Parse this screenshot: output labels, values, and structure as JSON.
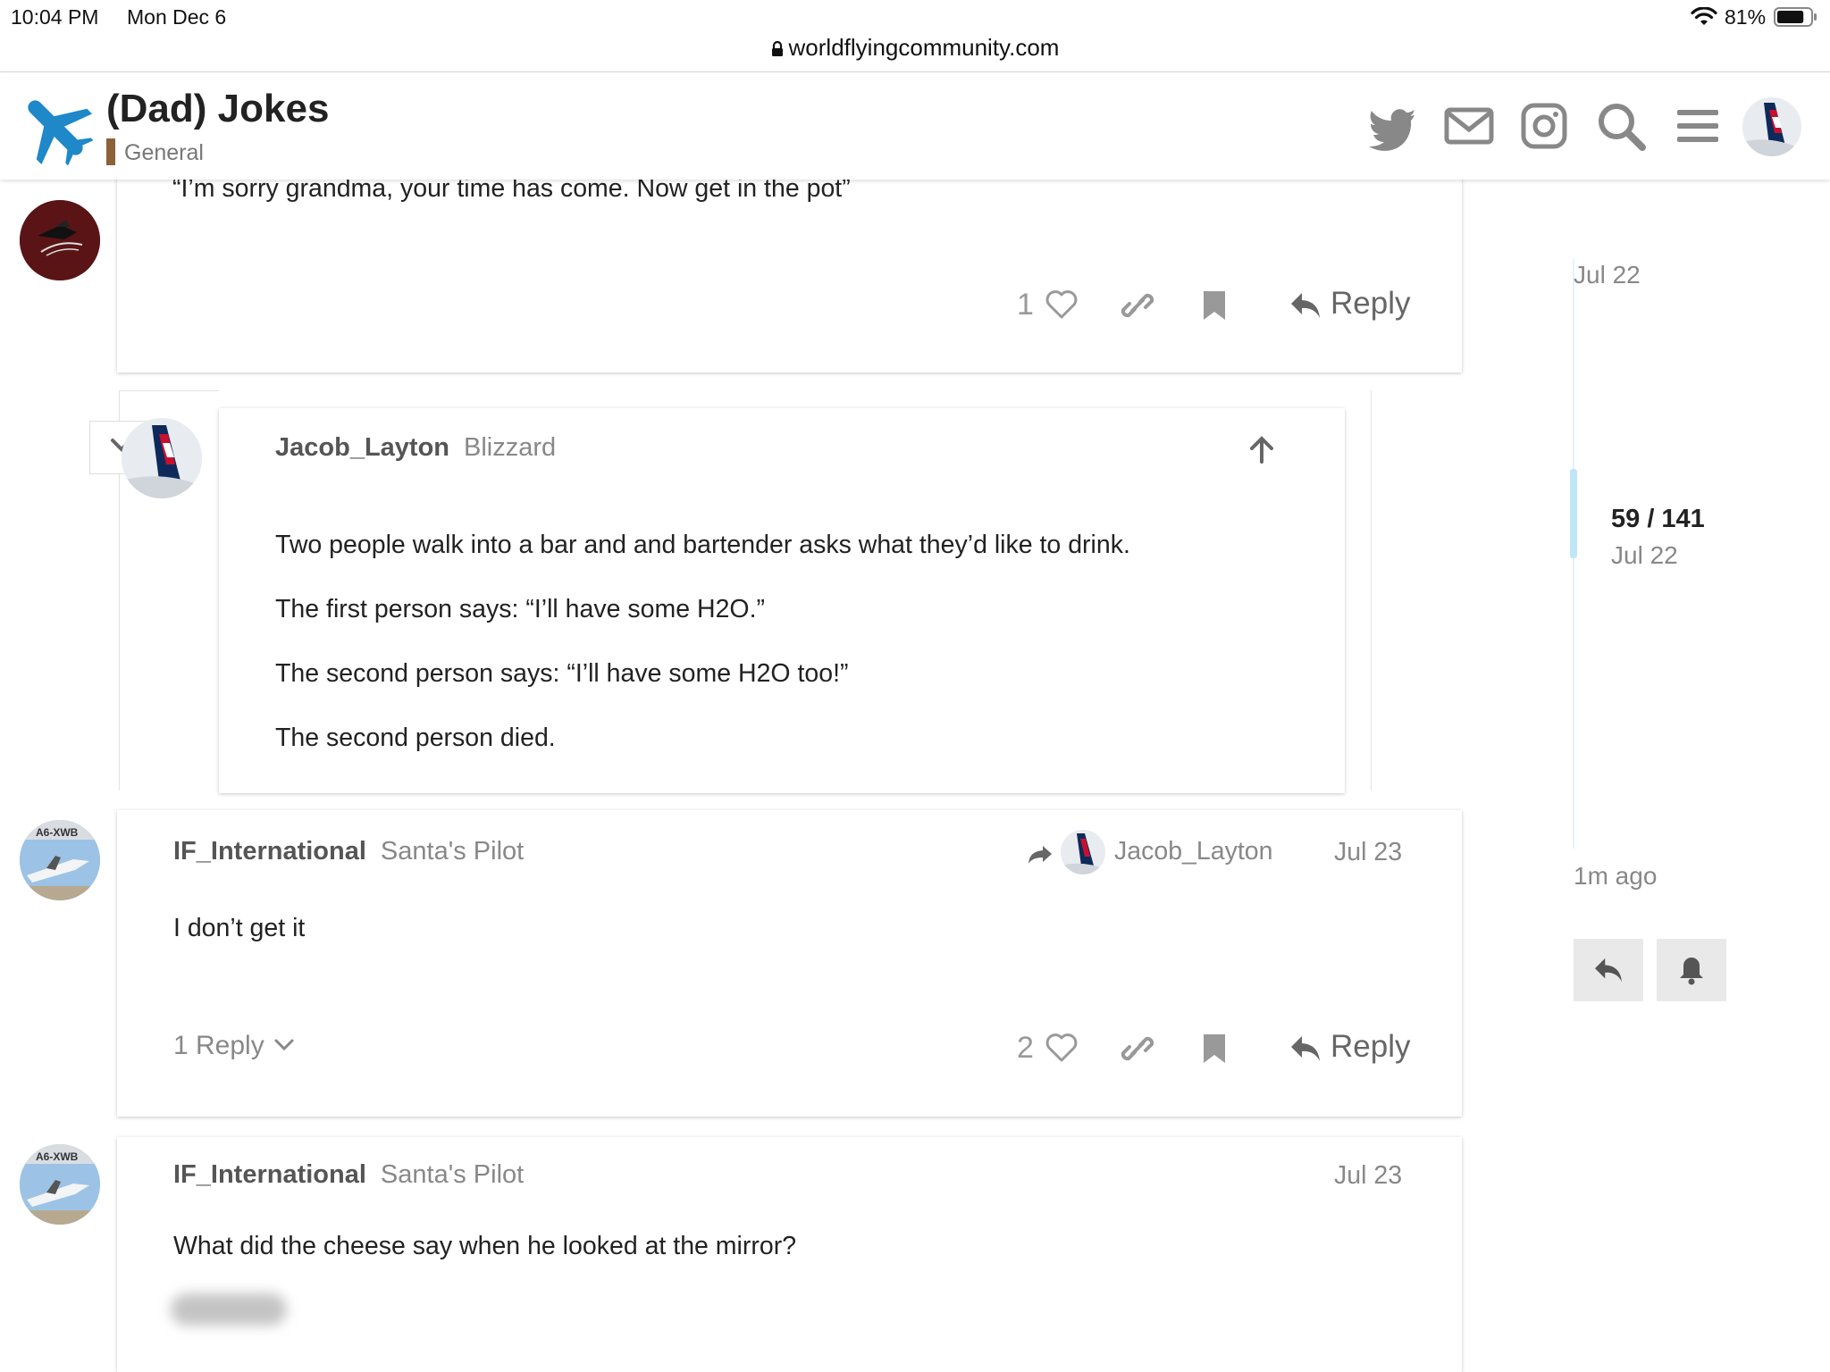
{
  "status": {
    "time": "10:04 PM",
    "date": "Mon Dec 6",
    "battery": "81%",
    "battery_level": 0.81,
    "url": "worldflyingcommunity.com"
  },
  "header": {
    "title": "(Dad) Jokes",
    "category": "General",
    "category_color": "#8C6238",
    "logo_color": "#1E88C8",
    "icons": [
      "twitter-icon",
      "mail-icon",
      "instagram-icon",
      "search-icon",
      "menu-icon",
      "user-avatar"
    ]
  },
  "posts": [
    {
      "text": "“I’m sorry grandma, your time has come. Now get in the pot”",
      "likes": "1",
      "reply_label": "Reply"
    },
    {
      "username": "Jacob_Layton",
      "user_title": "Blizzard",
      "paragraphs": [
        "Two people walk into a bar and and bartender asks what they’d like to drink.",
        "The first person says: “I’ll have some H2O.”",
        "The second person says: “I’ll have some H2O too!”",
        "The second person died."
      ]
    },
    {
      "username": "IF_International",
      "user_title": "Santa's Pilot",
      "reply_to": "Jacob_Layton",
      "date": "Jul 23",
      "text": "I don’t get it",
      "replies_count": "1 Reply",
      "likes": "2",
      "reply_label": "Reply"
    },
    {
      "username": "IF_International",
      "user_title": "Santa's Pilot",
      "date": "Jul 23",
      "text": "What did the cheese say when he looked at the mirror?"
    }
  ],
  "timeline": {
    "start_date": "Jul 22",
    "position": "59 / 141",
    "current_date": "Jul 22",
    "end": "1m ago",
    "progress": 0.42
  },
  "colors": {
    "accent": "#1E88C8",
    "timeline_handle": "#BFE6F8",
    "timeline_track": "#E3F2FA"
  }
}
